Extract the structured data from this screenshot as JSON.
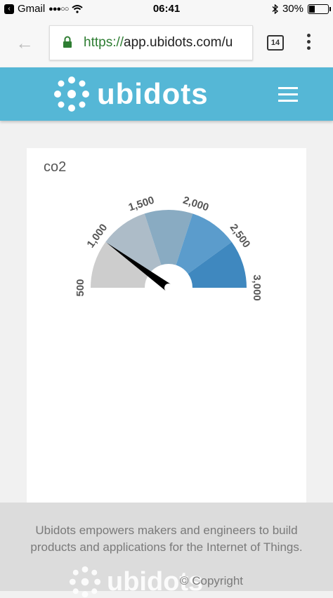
{
  "status": {
    "carrier": "Gmail",
    "signal": "●●●○○",
    "time": "06:41",
    "battery": "30%",
    "battery_level": 0.3
  },
  "browser": {
    "url_scheme": "https://",
    "url_rest": "app.ubidots.com/u",
    "tab_count": "14"
  },
  "header": {
    "logo_text": "ubidots"
  },
  "widget": {
    "title": "co2",
    "chart_data": {
      "type": "gauge",
      "min": 500,
      "max": 3000,
      "value": 1000,
      "tick_labels": [
        "500",
        "1,000",
        "1,500",
        "2,000",
        "2,500",
        "3,000"
      ],
      "bands": [
        {
          "from": 500,
          "to": 1000,
          "color": "#cdcdcd"
        },
        {
          "from": 1000,
          "to": 1500,
          "color": "#adbcc8"
        },
        {
          "from": 1500,
          "to": 2000,
          "color": "#89abc2"
        },
        {
          "from": 2000,
          "to": 2500,
          "color": "#5b9ccc"
        },
        {
          "from": 2500,
          "to": 3000,
          "color": "#3f88bf"
        }
      ]
    }
  },
  "footer": {
    "tagline": "Ubidots empowers makers and engineers to build products and applications for the Internet of Things.",
    "logo_text": "ubidots",
    "copyright": "© Copyright"
  }
}
